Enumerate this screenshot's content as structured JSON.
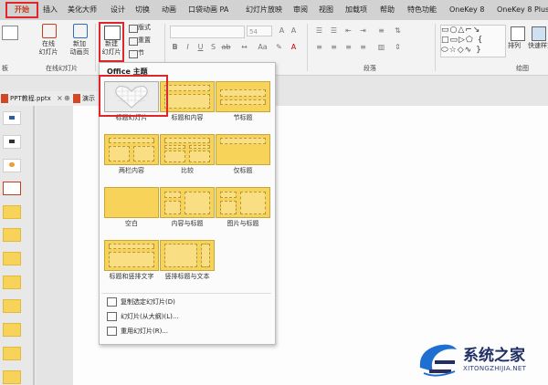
{
  "ribbon_tabs": [
    "开始",
    "插入",
    "美化大师",
    "设计",
    "切换",
    "动画",
    "口袋动画 PA",
    "幻灯片放映",
    "审阅",
    "视图",
    "加载项",
    "帮助",
    "特色功能",
    "OneKey 8",
    "OneKey 8 Plus"
  ],
  "ribbon": {
    "new_slide_label": "新建\n幻灯片",
    "online_slides_label": "在线\n幻灯片",
    "new_animation_label": "新加\n动画页",
    "online_group": "在线幻灯片",
    "clipboard_group": "板",
    "layout_btn": "版式",
    "reset_btn": "重置",
    "section_btn": "节",
    "font_size": "54",
    "paragraph_group": "段落",
    "drawing_group": "绘图",
    "arrange_btn": "排列",
    "quickstyle_btn": "快速样式"
  },
  "document_tabs": [
    "PPT教程.pptx",
    "演示"
  ],
  "dropdown": {
    "title": "Office 主题",
    "layouts": [
      "标题幻灯片",
      "标题和内容",
      "节标题",
      "两栏内容",
      "比较",
      "仅标题",
      "空白",
      "内容与标题",
      "图片与标题",
      "标题和竖排文字",
      "竖排标题与文本"
    ],
    "menu": [
      "复制选定幻灯片(D)",
      "幻灯片(从大纲)(L)...",
      "重用幻灯片(R)..."
    ]
  },
  "watermark": {
    "text": "系统之家",
    "url": "XITONGZHIJIA.NET"
  },
  "colors": {
    "accent_red": "#e0262a",
    "layout_yellow": "#f7d35a"
  }
}
